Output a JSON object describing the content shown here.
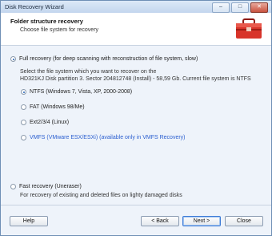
{
  "window": {
    "title": "Disk Recovery Wizard",
    "minimize": "–",
    "maximize": "□",
    "close": "✕"
  },
  "header": {
    "title": "Folder structure recovery",
    "subtitle": "Choose file system for recovery"
  },
  "options": {
    "full": {
      "label": "Full recovery (for deep scanning with reconstruction of file system, slow)",
      "selected": true
    },
    "description_line1": "Select the file system which you want to recover on the",
    "description_line2": "HD321KJ Disk partition 3. Sector 204812748 (Install) - 58,59 Gb. Current file system is NTFS",
    "fs": [
      {
        "label": "NTFS (Windows 7, Vista, XP, 2000-2008)",
        "selected": true
      },
      {
        "label": "FAT (Windows 98/Me)",
        "selected": false
      },
      {
        "label": "Ext2/3/4 (Linux)",
        "selected": false
      },
      {
        "label": "VMFS (VMware ESX/ESXi) (available only in VMFS Recovery)",
        "selected": false,
        "disabled": true
      }
    ],
    "fast": {
      "label": "Fast recovery (Uneraser)",
      "selected": false,
      "description": "For recovery of existing and deleted files on lighty damaged disks"
    }
  },
  "buttons": {
    "help": "Help",
    "back": "< Back",
    "next": "Next >",
    "close": "Close"
  }
}
